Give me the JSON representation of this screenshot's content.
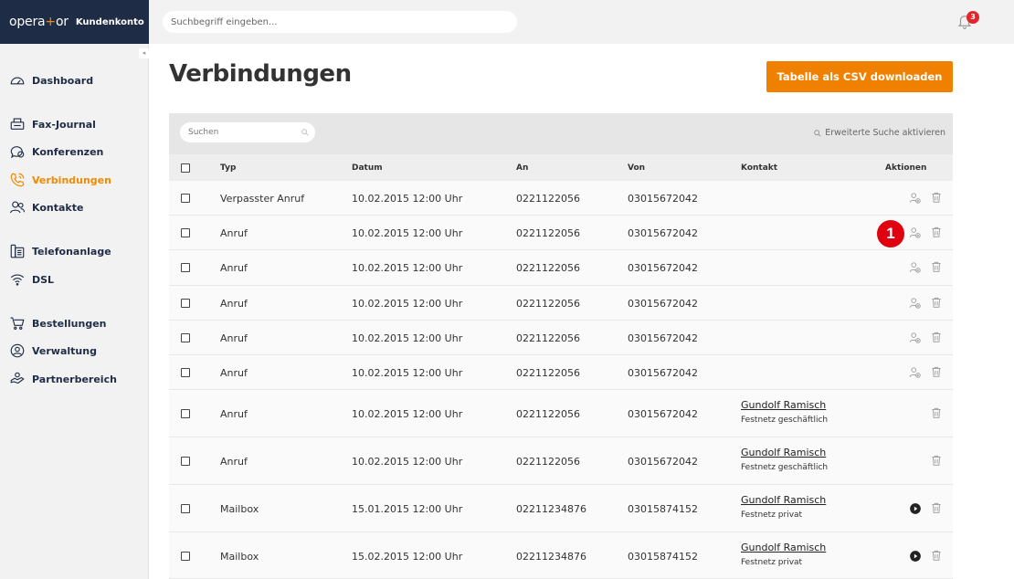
{
  "brand": {
    "logo_a": "opera",
    "logo_plus": "+",
    "logo_b": "or",
    "account": "Kundenkonto"
  },
  "search": {
    "placeholder": "Suchbegriff eingeben..."
  },
  "notifications": {
    "count": "3",
    "icon": "bell-icon"
  },
  "sidebar": {
    "collapse_glyph": "◂",
    "items": [
      {
        "label": "Dashboard",
        "icon": "speedometer-icon"
      },
      {
        "label": "Fax-Journal",
        "icon": "fax-icon"
      },
      {
        "label": "Konferenzen",
        "icon": "conference-icon"
      },
      {
        "label": "Verbindungen",
        "icon": "phone-icon",
        "active": true
      },
      {
        "label": "Kontakte",
        "icon": "contacts-icon"
      },
      {
        "label": "Telefonanlage",
        "icon": "phone-system-icon"
      },
      {
        "label": "DSL",
        "icon": "wifi-icon"
      },
      {
        "label": "Bestellungen",
        "icon": "cart-icon"
      },
      {
        "label": "Verwaltung",
        "icon": "user-circle-icon"
      },
      {
        "label": "Partnerbereich",
        "icon": "partner-icon"
      }
    ]
  },
  "main": {
    "title": "Verbindungen",
    "csv_button": "Tabelle als CSV downloaden",
    "table_search_placeholder": "Suchen",
    "advanced_search": "Erweiterte Suche aktivieren"
  },
  "table": {
    "headers": {
      "typ": "Typ",
      "datum": "Datum",
      "an": "An",
      "von": "Von",
      "kontakt": "Kontakt",
      "aktionen": "Aktionen"
    },
    "rows": [
      {
        "typ": "Verpasster Anruf",
        "datum": "10.02.2015 12:00 Uhr",
        "an": "0221122056",
        "von": "03015672042",
        "kontakt_name": "",
        "kontakt_sub": "",
        "action": "add-contact"
      },
      {
        "typ": "Anruf",
        "datum": "10.02.2015 12:00 Uhr",
        "an": "0221122056",
        "von": "03015672042",
        "kontakt_name": "",
        "kontakt_sub": "",
        "action": "add-contact"
      },
      {
        "typ": "Anruf",
        "datum": "10.02.2015 12:00 Uhr",
        "an": "0221122056",
        "von": "03015672042",
        "kontakt_name": "",
        "kontakt_sub": "",
        "action": "add-contact"
      },
      {
        "typ": "Anruf",
        "datum": "10.02.2015 12:00 Uhr",
        "an": "0221122056",
        "von": "03015672042",
        "kontakt_name": "",
        "kontakt_sub": "",
        "action": "add-contact"
      },
      {
        "typ": "Anruf",
        "datum": "10.02.2015 12:00 Uhr",
        "an": "0221122056",
        "von": "03015672042",
        "kontakt_name": "",
        "kontakt_sub": "",
        "action": "add-contact"
      },
      {
        "typ": "Anruf",
        "datum": "10.02.2015 12:00 Uhr",
        "an": "0221122056",
        "von": "03015672042",
        "kontakt_name": "",
        "kontakt_sub": "",
        "action": "add-contact"
      },
      {
        "typ": "Anruf",
        "datum": "10.02.2015 12:00 Uhr",
        "an": "0221122056",
        "von": "03015672042",
        "kontakt_name": "Gundolf Ramisch",
        "kontakt_sub": "Festnetz geschäftlich",
        "action": "none"
      },
      {
        "typ": "Anruf",
        "datum": "10.02.2015 12:00 Uhr",
        "an": "0221122056",
        "von": "03015672042",
        "kontakt_name": "Gundolf Ramisch",
        "kontakt_sub": "Festnetz geschäftlich",
        "action": "none"
      },
      {
        "typ": "Mailbox",
        "datum": "15.01.2015 12:00 Uhr",
        "an": "02211234876",
        "von": "03015874152",
        "kontakt_name": "Gundolf Ramisch",
        "kontakt_sub": "Festnetz privat",
        "action": "play"
      },
      {
        "typ": "Mailbox",
        "datum": "15.02.2015 12:00 Uhr",
        "an": "02211234876",
        "von": "03015874152",
        "kontakt_name": "Gundolf Ramisch",
        "kontakt_sub": "Festnetz privat",
        "action": "play"
      }
    ]
  },
  "annotation": {
    "marker_label": "1"
  },
  "colors": {
    "accent": "#f08000",
    "brand_bg": "#1f2c45",
    "badge": "#e3242b",
    "marker": "#e00010"
  }
}
